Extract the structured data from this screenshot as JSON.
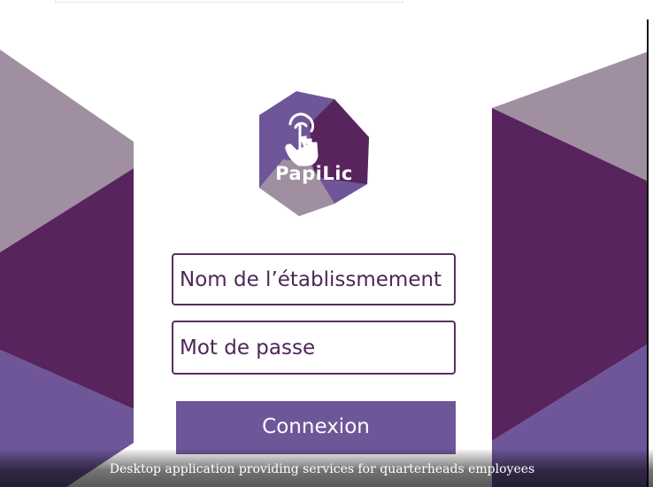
{
  "logo": {
    "text": "PapiLic",
    "icon": "touch-hand-icon"
  },
  "form": {
    "name_placeholder": "Nom de l’établissmement",
    "password_placeholder": "Mot de passe",
    "login_label": "Connexion"
  },
  "caption": "Desktop application providing services for quarterheads employees",
  "colors": {
    "dark_purple": "#58245e",
    "mid_purple": "#6e5699",
    "grey_purple": "#a08fa1",
    "text_purple": "#4e2659"
  }
}
